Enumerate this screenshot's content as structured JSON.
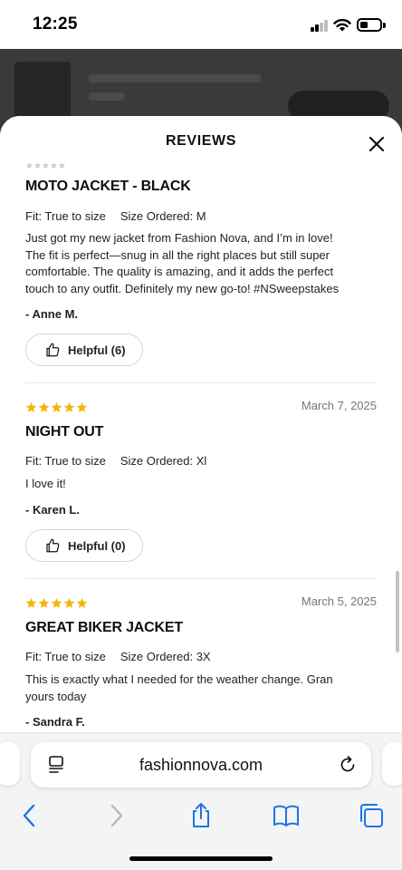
{
  "status_bar": {
    "time": "12:25",
    "battery_level": 0.35
  },
  "sheet": {
    "title": "REVIEWS"
  },
  "reviews": [
    {
      "stars": 5,
      "date": "",
      "title": "MOTO JACKET - BLACK",
      "fit": "Fit: True to size",
      "size": "Size Ordered: M",
      "body": "Just got my new jacket from Fashion Nova, and I’m in love!\nThe fit is perfect—snug in all the right places but still super\ncomfortable. The quality is amazing, and it adds the perfect\ntouch to any outfit. Definitely my new go-to! #NSweepstakes",
      "author": "- Anne M.",
      "helpful": "Helpful (6)"
    },
    {
      "stars": 5,
      "date": "March 7, 2025",
      "title": "NIGHT OUT",
      "fit": "Fit: True to size",
      "size": "Size Ordered: Xl",
      "body": "I love it!",
      "author": "- Karen L.",
      "helpful": "Helpful (0)"
    },
    {
      "stars": 5,
      "date": "March 5, 2025",
      "title": "GREAT BIKER JACKET",
      "fit": "Fit: True to size",
      "size": "Size Ordered: 3X",
      "body": "This is exactly what I needed for the weather change. Gran\nyours today",
      "author": "- Sandra F.",
      "helpful": ""
    }
  ],
  "browser": {
    "url": "fashionnova.com"
  },
  "colors": {
    "star": "#f5b50a",
    "accent": "#1a73e8",
    "backdrop": "#3a3a3a"
  },
  "icons": [
    "close-icon",
    "thumbs-up-icon",
    "star-icon",
    "reader-icon",
    "reload-icon",
    "back-icon",
    "forward-icon",
    "share-icon",
    "bookmarks-icon",
    "tabs-icon"
  ]
}
